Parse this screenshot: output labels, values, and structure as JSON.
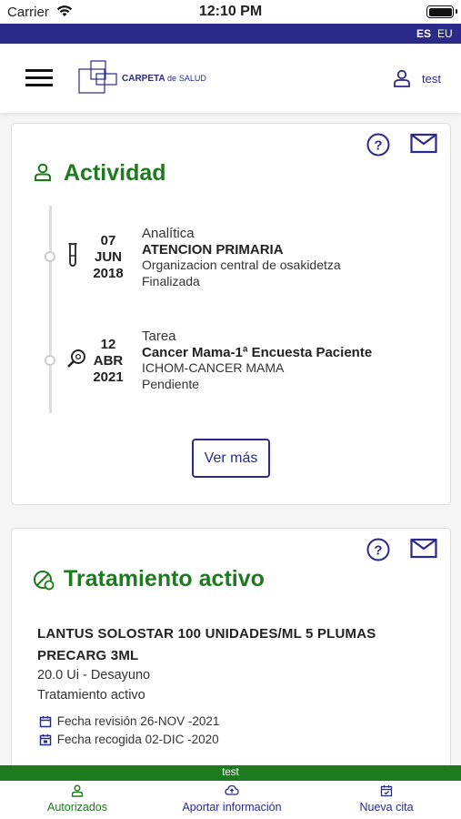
{
  "status_bar": {
    "carrier": "Carrier",
    "time": "12:10 PM"
  },
  "language": {
    "es": "ES",
    "eu": "EU"
  },
  "header": {
    "logo_text_main": "CARPETA",
    "logo_text_de": "de",
    "logo_text_end": "SALUD",
    "user_name": "test"
  },
  "actividad": {
    "title": "Actividad",
    "items": [
      {
        "day": "07",
        "month": "JUN",
        "year": "2018",
        "type": "Analítica",
        "title": "ATENCION PRIMARIA",
        "org": "Organizacion central de osakidetza",
        "status": "Finalizada",
        "icon": "test-tube-icon"
      },
      {
        "day": "12",
        "month": "ABR",
        "year": "2021",
        "type": "Tarea",
        "title": "Cancer Mama-1ª Encuesta Paciente",
        "org": "ICHOM-CANCER MAMA",
        "status": "Pendiente",
        "icon": "magnifier-task-icon"
      }
    ],
    "ver_mas": "Ver más"
  },
  "tratamiento": {
    "title": "Tratamiento activo",
    "med_name": "LANTUS SOLOSTAR 100 UNIDADES/ML 5 PLUMAS PRECARG 3ML",
    "dose": "20.0 Ui - Desayuno",
    "state": "Tratamiento activo",
    "fecha_revision": "Fecha revisión 26-NOV -2021",
    "fecha_recogida": "Fecha recogida 02-DIC -2020"
  },
  "user_bar": "test",
  "tabs": {
    "autorizados": "Autorizados",
    "aportar": "Aportar información",
    "nueva_cita": "Nueva cita"
  },
  "colors": {
    "navy": "#2a2a8a",
    "green": "#1e7a1e"
  }
}
